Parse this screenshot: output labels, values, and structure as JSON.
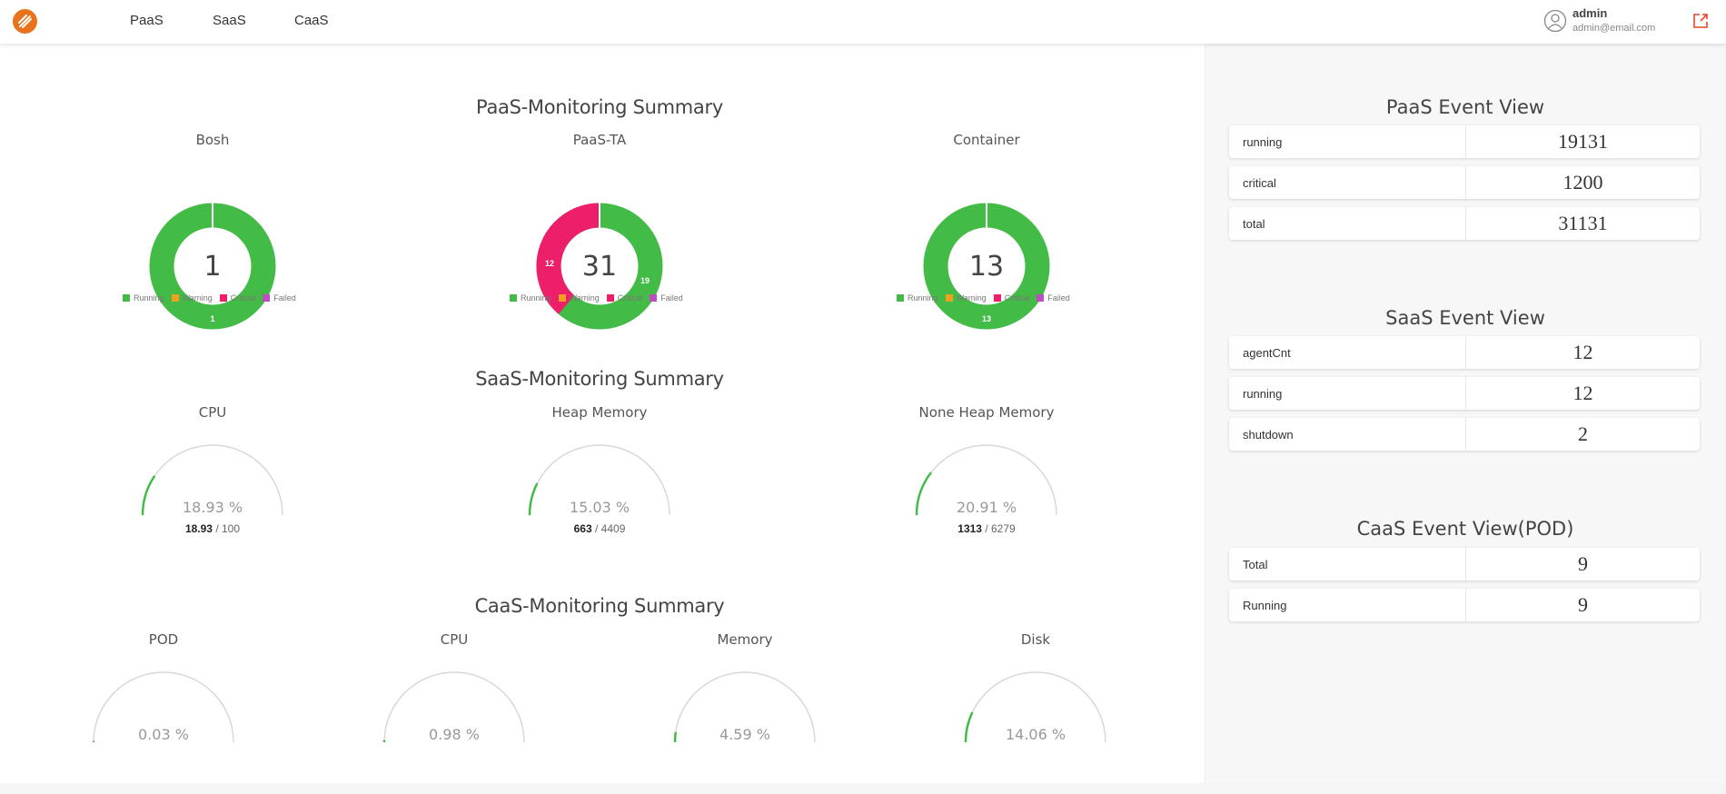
{
  "nav": {
    "items": [
      "PaaS",
      "SaaS",
      "CaaS"
    ],
    "user_name": "admin",
    "user_email": "admin@email.com"
  },
  "colors": {
    "running": "#43bb47",
    "warning": "#f0a01e",
    "critical": "#ee1f6a",
    "failed": "#c04cc4",
    "accent": "#e8731c"
  },
  "legend": [
    "Running",
    "Warning",
    "Critical",
    "Failed"
  ],
  "paas": {
    "title": "PaaS-Monitoring Summary",
    "donuts": [
      {
        "title": "Bosh",
        "total": "1",
        "running": 1,
        "critical": 0,
        "running_label": "1",
        "critical_label": ""
      },
      {
        "title": "PaaS-TA",
        "total": "31",
        "running": 19,
        "critical": 12,
        "running_label": "19",
        "critical_label": "12"
      },
      {
        "title": "Container",
        "total": "13",
        "running": 13,
        "critical": 0,
        "running_label": "13",
        "critical_label": ""
      }
    ]
  },
  "saas": {
    "title": "SaaS-Monitoring Summary",
    "gauges": [
      {
        "title": "CPU",
        "percent": 18.93,
        "percent_text": "18.93 %",
        "used": "18.93",
        "max": "/ 100"
      },
      {
        "title": "Heap Memory",
        "percent": 15.03,
        "percent_text": "15.03 %",
        "used": "663",
        "max": "/ 4409"
      },
      {
        "title": "None Heap Memory",
        "percent": 20.91,
        "percent_text": "20.91 %",
        "used": "1313",
        "max": "/ 6279"
      }
    ]
  },
  "caas": {
    "title": "CaaS-Monitoring Summary",
    "gauges": [
      {
        "title": "POD",
        "percent": 0.03,
        "percent_text": "0.03 %"
      },
      {
        "title": "CPU",
        "percent": 0.98,
        "percent_text": "0.98 %"
      },
      {
        "title": "Memory",
        "percent": 4.59,
        "percent_text": "4.59 %"
      },
      {
        "title": "Disk",
        "percent": 14.06,
        "percent_text": "14.06 %"
      }
    ]
  },
  "side": {
    "paas": {
      "title": "PaaS Event View",
      "rows": [
        {
          "label": "running",
          "value": "19131"
        },
        {
          "label": "critical",
          "value": "1200"
        },
        {
          "label": "total",
          "value": "31131"
        }
      ]
    },
    "saas": {
      "title": "SaaS Event View",
      "rows": [
        {
          "label": "agentCnt",
          "value": "12"
        },
        {
          "label": "running",
          "value": "12"
        },
        {
          "label": "shutdown",
          "value": "2"
        }
      ]
    },
    "caas": {
      "title": "CaaS Event View(POD)",
      "rows": [
        {
          "label": "Total",
          "value": "9"
        },
        {
          "label": "Running",
          "value": "9"
        }
      ]
    }
  }
}
